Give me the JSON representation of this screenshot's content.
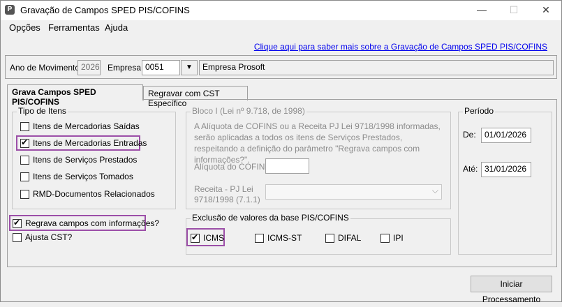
{
  "window": {
    "title": "Gravação de Campos SPED PIS/COFINS",
    "icon": "P",
    "minimize": "—",
    "maximize": "☐",
    "close": "✕"
  },
  "menu": [
    "Opções",
    "Ferramentas",
    "Ajuda"
  ],
  "help_link": "Clique aqui para saber mais sobre a Gravação de Campos SPED PIS/COFINS",
  "top": {
    "ano_label": "Ano de Movimento:",
    "ano_value": "2026",
    "empresa_label": "Empresa:",
    "empresa_code": "0051",
    "empresa_name": "Empresa Prosoft",
    "dropdown_glyph": "▼"
  },
  "tabs": [
    "Grava Campos SPED PIS/COFINS",
    "Regravar com CST Específico"
  ],
  "tipo_itens": {
    "title": "Tipo de Itens",
    "items": [
      {
        "label": "Itens de Mercadorias Saídas",
        "checked": false
      },
      {
        "label": "Itens de Mercadorias Entradas",
        "checked": true
      },
      {
        "label": "Itens de Serviços Prestados",
        "checked": false
      },
      {
        "label": "Itens de Serviços Tomados",
        "checked": false
      },
      {
        "label": "RMD-Documentos Relacionados",
        "checked": false
      }
    ]
  },
  "regrava": {
    "label": "Regrava campos com informações?",
    "checked": true
  },
  "ajusta": {
    "label": "Ajusta CST?",
    "checked": false
  },
  "bloco": {
    "title": "Bloco I (Lei nº 9.718, de 1998)",
    "description": "A Alíquota de COFINS ou a Receita PJ Lei 9718/1998 informadas, serão aplicadas a todos os itens de Serviços Prestados, respeitando a definição do parâmetro \"Regrava campos com informações?\".",
    "aliquota_label": "Alíquota do COFINS",
    "receita_label": "Receita - PJ Lei 9718/1998 (7.1.1)",
    "select_glyph": "⌵"
  },
  "exclusao": {
    "title": "Exclusão de valores da base PIS/COFINS",
    "items": [
      {
        "label": "ICMS",
        "checked": true
      },
      {
        "label": "ICMS-ST",
        "checked": false
      },
      {
        "label": "DIFAL",
        "checked": false
      },
      {
        "label": "IPI",
        "checked": false
      }
    ]
  },
  "periodo": {
    "title": "Período",
    "de_label": "De:",
    "de_value": "01/01/2026",
    "ate_label": "Até:",
    "ate_value": "31/01/2026"
  },
  "start_button": "Iniciar Processamento",
  "colors": {
    "highlight": "#9c4fa8",
    "link": "#0000ee"
  }
}
